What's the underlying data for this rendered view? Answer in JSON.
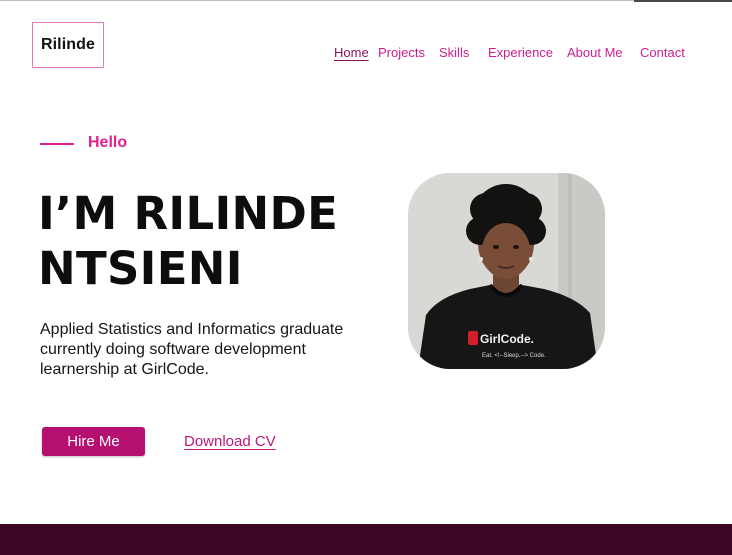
{
  "brand": {
    "logo_text": "Rilinde"
  },
  "nav": {
    "items": [
      {
        "label": "Home",
        "active": true
      },
      {
        "label": "Projects",
        "active": false
      },
      {
        "label": "Skills",
        "active": false
      },
      {
        "label": "Experience",
        "active": false
      },
      {
        "label": "About Me",
        "active": false
      },
      {
        "label": "Contact",
        "active": false
      }
    ]
  },
  "hero": {
    "greeting": "Hello",
    "title_line1": "I’M RILINDE",
    "title_line2": "NTSIENI",
    "bio": "Applied Statistics and Informatics graduate currently  doing software development learnership at GirlCode.",
    "hire_label": "Hire Me",
    "download_label": "Download CV",
    "photo_shirt_text": "GirlCode.",
    "photo_shirt_subtext": "Eat. <!--Sleep.--> Code."
  },
  "colors": {
    "accent": "#e0218f",
    "button": "#b5106f",
    "footer": "#3b0724"
  },
  "icons": {
    "profile_photo": "portrait-photo"
  }
}
